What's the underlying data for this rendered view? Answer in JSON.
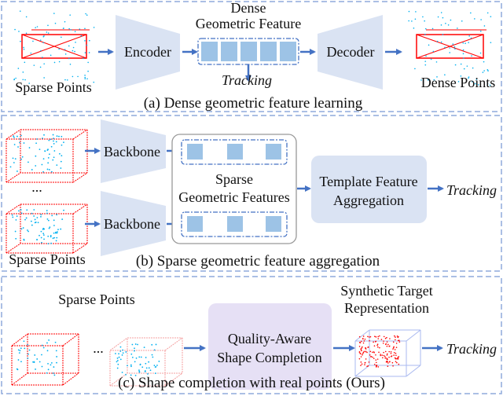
{
  "panel_a": {
    "input_label": "Sparse Points",
    "encoder": "Encoder",
    "feature_title_1": "Dense",
    "feature_title_2": "Geometric Feature",
    "tracking": "Tracking",
    "decoder": "Decoder",
    "output_label": "Dense Points",
    "caption": "(a) Dense geometric feature learning"
  },
  "panel_b": {
    "backbone_1": "Backbone",
    "backbone_2": "Backbone",
    "ellipsis": "...",
    "features_1": "Sparse",
    "features_2": "Geometric Features",
    "aggregation_1": "Template Feature",
    "aggregation_2": "Aggregation",
    "tracking": "Tracking",
    "input_label": "Sparse Points",
    "caption": "(b) Sparse geometric feature aggregation"
  },
  "panel_c": {
    "input_label": "Sparse Points",
    "ellipsis": "...",
    "completion_1": "Quality-Aware",
    "completion_2": "Shape Completion",
    "synthetic_1": "Synthetic Target",
    "synthetic_2": "Representation",
    "tracking": "Tracking",
    "caption": "(c) Shape completion with real points (Ours)"
  },
  "colors": {
    "panel_border": "#8faadc",
    "block_fill": "#dae3f3",
    "feature_cell": "#9dc3e6",
    "arrow": "#4472c4",
    "completion_fill": "#e6e0f5",
    "box_edge": "#ff0000",
    "points": "#00b0f0"
  }
}
